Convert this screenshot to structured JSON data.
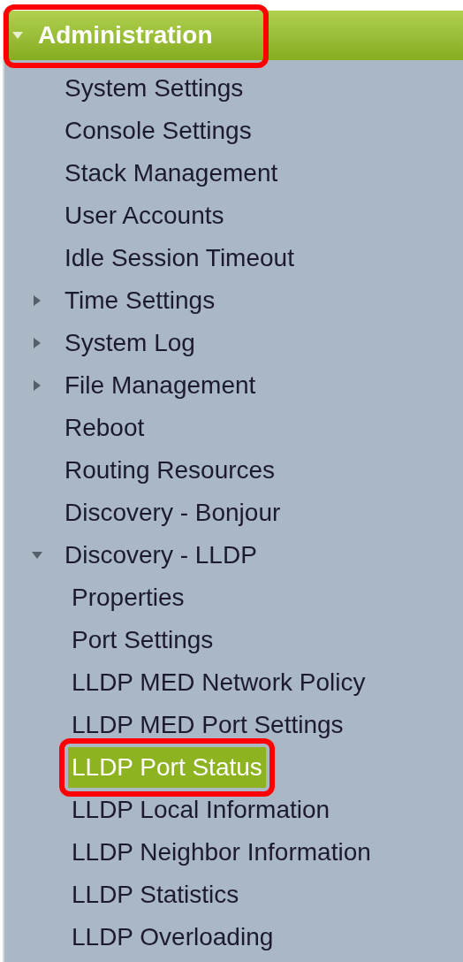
{
  "header": {
    "label": "Administration",
    "expanded": true,
    "highlighted": true
  },
  "items": [
    {
      "kind": "page",
      "label": "System Settings",
      "selected": false
    },
    {
      "kind": "page",
      "label": "Console Settings",
      "selected": false
    },
    {
      "kind": "page",
      "label": "Stack Management",
      "selected": false
    },
    {
      "kind": "page",
      "label": "User Accounts",
      "selected": false
    },
    {
      "kind": "page",
      "label": "Idle Session Timeout",
      "selected": false
    },
    {
      "kind": "folder",
      "label": "Time Settings",
      "selected": false,
      "expanded": false
    },
    {
      "kind": "folder",
      "label": "System Log",
      "selected": false,
      "expanded": false
    },
    {
      "kind": "folder",
      "label": "File Management",
      "selected": false,
      "expanded": false
    },
    {
      "kind": "page",
      "label": "Reboot",
      "selected": false
    },
    {
      "kind": "page",
      "label": "Routing Resources",
      "selected": false
    },
    {
      "kind": "page",
      "label": "Discovery - Bonjour",
      "selected": false
    },
    {
      "kind": "folder",
      "label": "Discovery - LLDP",
      "selected": false,
      "expanded": true,
      "children": [
        {
          "label": "Properties",
          "selected": false,
          "highlighted": false
        },
        {
          "label": "Port Settings",
          "selected": false,
          "highlighted": false
        },
        {
          "label": "LLDP MED Network Policy",
          "selected": false,
          "highlighted": false
        },
        {
          "label": "LLDP MED Port Settings",
          "selected": false,
          "highlighted": false
        },
        {
          "label": "LLDP Port Status",
          "selected": true,
          "highlighted": true
        },
        {
          "label": "LLDP Local Information",
          "selected": false,
          "highlighted": false
        },
        {
          "label": "LLDP Neighbor Information",
          "selected": false,
          "highlighted": false
        },
        {
          "label": "LLDP Statistics",
          "selected": false,
          "highlighted": false
        },
        {
          "label": "LLDP Overloading",
          "selected": false,
          "highlighted": false
        }
      ]
    }
  ]
}
